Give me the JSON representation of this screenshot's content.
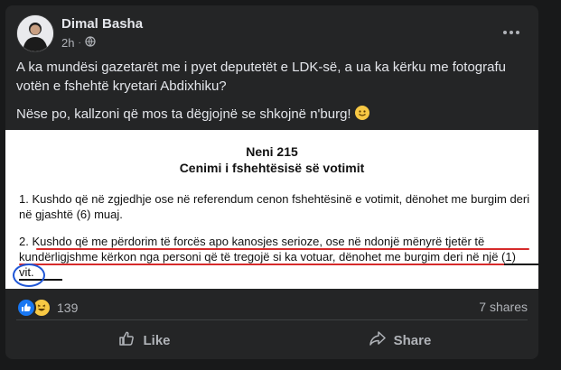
{
  "post": {
    "author": "Dimal Basha",
    "time": "2h",
    "privacy_icon": "globe-icon",
    "text_line1": "A ka mundësi gazetarët me i pyet deputetët e LDK-së, a ua ka kërku me fotografu votën e fshehtë kryetari Abdixhiku?",
    "text_line2": "Nëse po, kallzoni që mos ta dëgjojnë se shkojnë n'burg!",
    "emoji": "slightly-smiling-face-icon"
  },
  "document": {
    "title": "Neni 215",
    "subtitle": "Cenimi i fshehtësisë së votimit",
    "paragraph1": "1.  Kushdo që në zgjedhje ose në referendum cenon fshehtësinë e votimit, dënohet me burgim deri në gjashtë (6) muaj.",
    "paragraph2": "2.  Kushdo që me përdorim të forcës apo kanosjes serioze, ose në ndonjë mënyrë tjetër të kundërligjshme kërkon nga personi që të tregojë si ka votuar, dënohet me burgim deri në një (1) vit.",
    "annotation_color": "#d62b2b",
    "circle_color": "#1f56d6"
  },
  "stats": {
    "reaction_count": "139",
    "shares": "7 shares",
    "reactions": [
      "like-icon",
      "haha-icon"
    ]
  },
  "actions": {
    "like_label": "Like",
    "share_label": "Share"
  },
  "colors": {
    "background": "#18191a",
    "card": "#242526",
    "text": "#e4e6eb",
    "muted": "#b0b3b8",
    "like_blue": "#1877f2"
  }
}
